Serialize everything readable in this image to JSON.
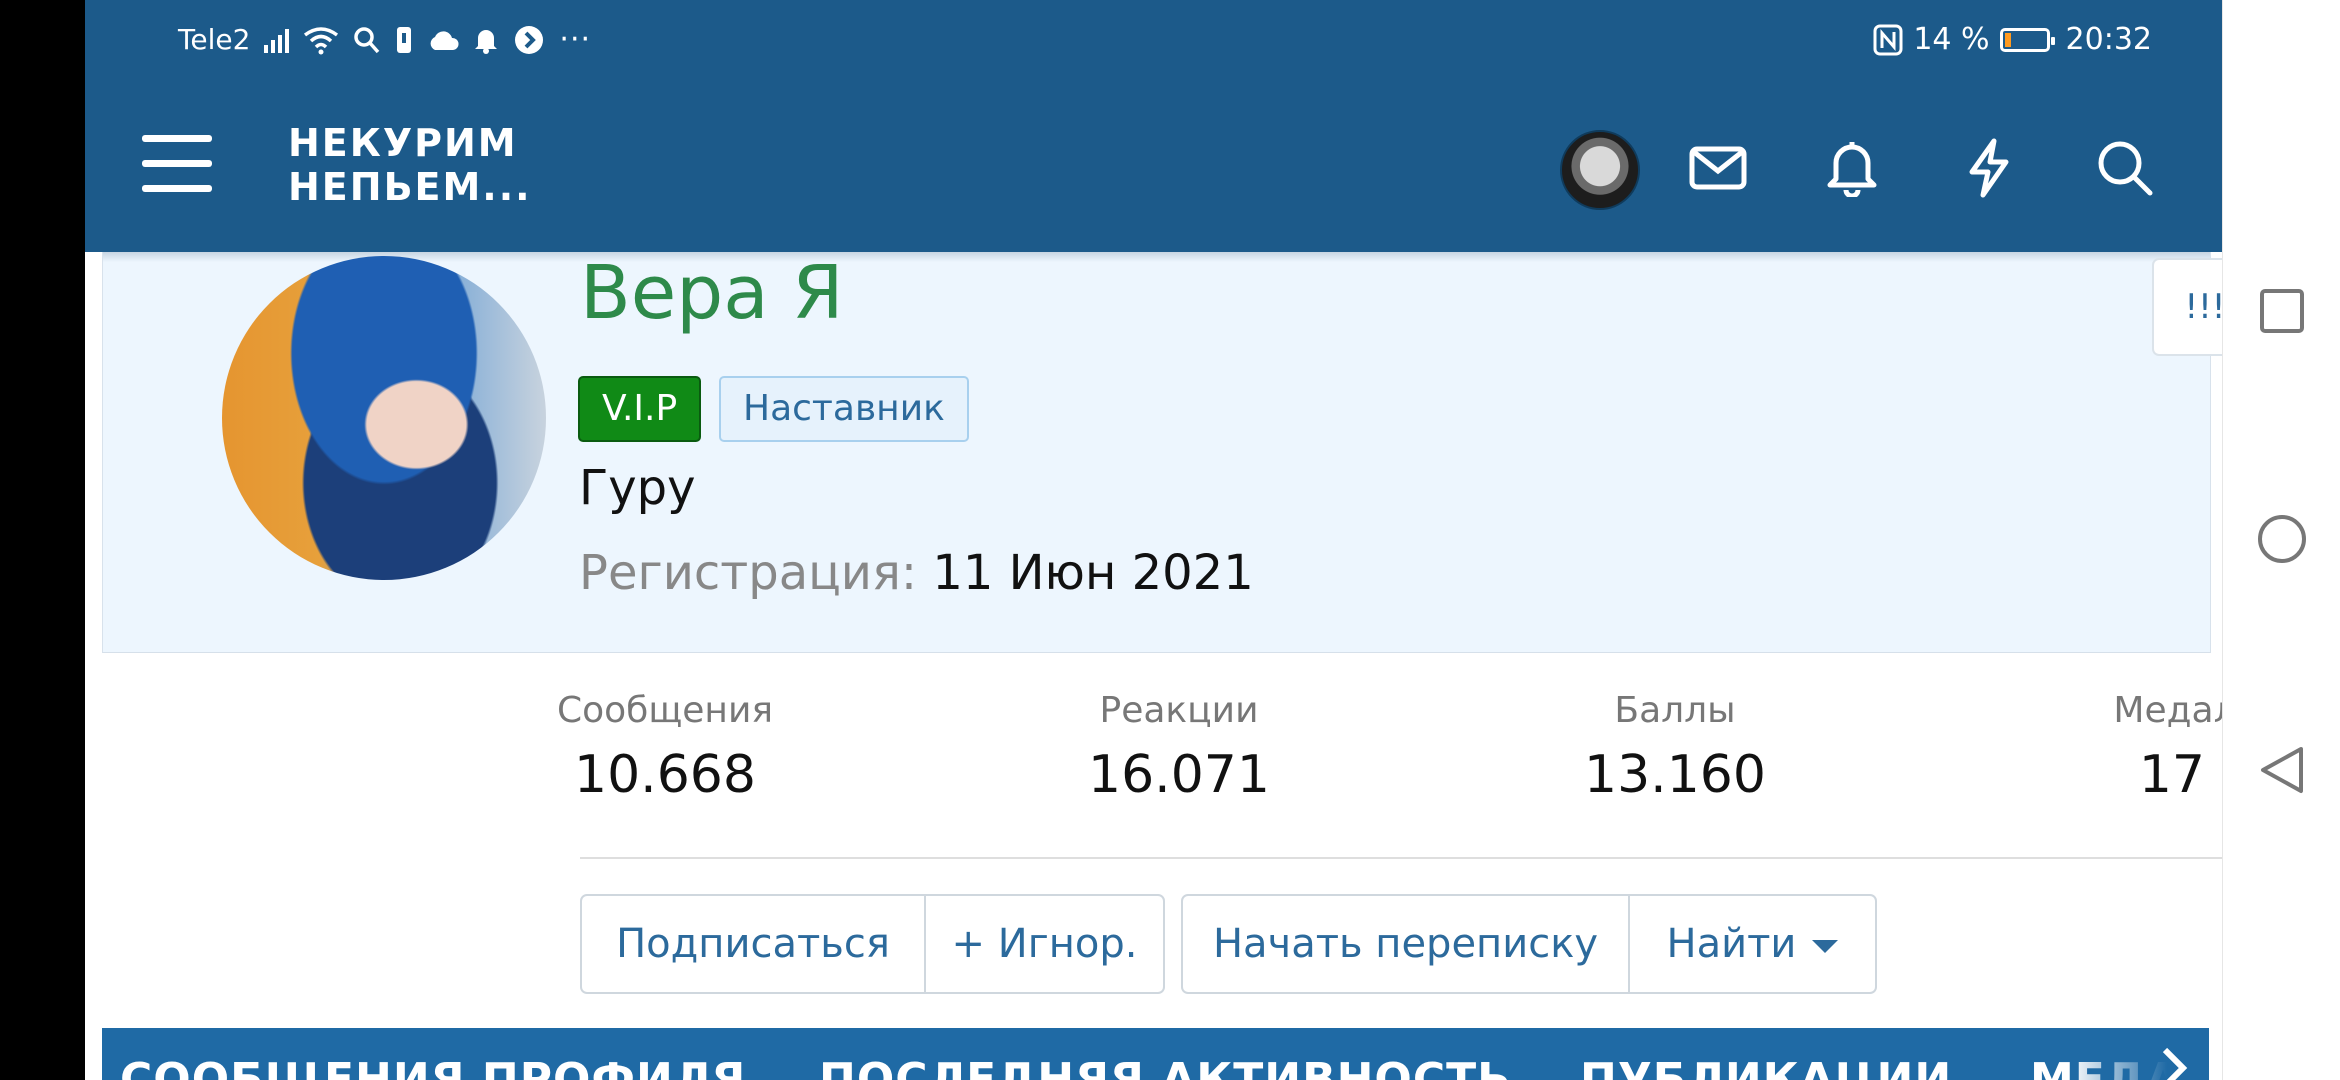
{
  "status_bar": {
    "carrier": "Tele2",
    "battery_text": "14 %",
    "time": "20:32",
    "battery_level": 0.14
  },
  "app_header": {
    "logo_line1": "НЕКУРИМ",
    "logo_line2": "НЕПЬЕМ..."
  },
  "profile": {
    "name": "Вера Я",
    "badges": [
      "V.I.P",
      "Наставник"
    ],
    "rank": "Гуру",
    "registration_label": "Регистрация:",
    "registration_date": "11 Июн 2021",
    "more_button": "!!!"
  },
  "stats": [
    {
      "label": "Сообщения",
      "value": "10.668"
    },
    {
      "label": "Реакции",
      "value": "16.071"
    },
    {
      "label": "Баллы",
      "value": "13.160"
    },
    {
      "label": "Медали",
      "value": "17"
    }
  ],
  "actions": {
    "follow": "Подписаться",
    "ignore": "+ Игнор.",
    "start_conversation": "Начать переписку",
    "find": "Найти"
  },
  "tabs": [
    "СООБЩЕНИЯ ПРОФИЛЯ",
    "ПОСЛЕДНЯЯ АКТИВНОСТЬ",
    "ПУБЛИКАЦИИ",
    "МЕДАЛИ"
  ],
  "colors": {
    "header": "#1c5a8a",
    "name_green": "#2e8a4a",
    "vip_green": "#108a16",
    "link_blue": "#2c6a9c",
    "tab_bar": "#1f6aa5"
  }
}
